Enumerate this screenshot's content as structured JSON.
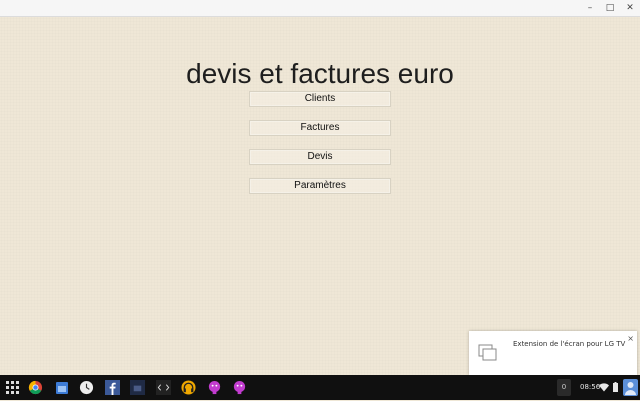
{
  "app": {
    "title": "devis et factures euro",
    "menu": [
      {
        "label": "Clients"
      },
      {
        "label": "Factures"
      },
      {
        "label": "Devis"
      },
      {
        "label": "Paramètres"
      }
    ]
  },
  "window_controls": {
    "minimize": "–",
    "maximize": "□",
    "close": "✕"
  },
  "notification": {
    "text": "Extension de l'écran pour LG TV",
    "close": "×",
    "icon": "cast-screen-icon"
  },
  "shelf": {
    "apps": [
      {
        "name": "chrome-icon"
      },
      {
        "name": "files-icon"
      },
      {
        "name": "clock-app-icon"
      },
      {
        "name": "facebook-icon"
      },
      {
        "name": "dark-app-icon"
      },
      {
        "name": "code-editor-icon"
      },
      {
        "name": "headphones-icon"
      },
      {
        "name": "android-app-icon"
      },
      {
        "name": "android-app-icon-2"
      }
    ],
    "notification_count": "0",
    "time": "08:56"
  },
  "colors": {
    "background": "#efe7d6",
    "shelf": "#101010"
  }
}
